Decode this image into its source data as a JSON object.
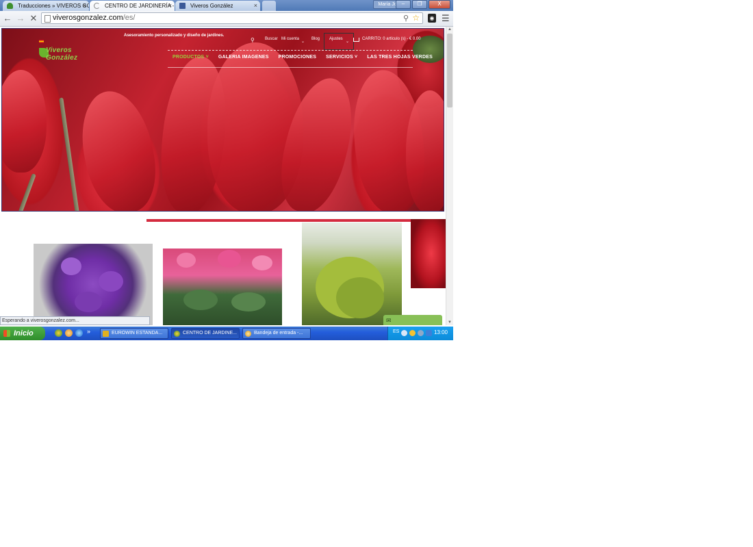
{
  "browser": {
    "tabs": [
      {
        "label": "Traducciones » VIVEROS GO",
        "active": false
      },
      {
        "label": "CENTRO DE JARDINERÍA - G",
        "active": true
      },
      {
        "label": "Viveros González",
        "active": false
      }
    ],
    "close_glyph": "×",
    "user_badge": "María José",
    "window_buttons": {
      "minimize": "–",
      "maximize": "❐",
      "close": "X"
    },
    "url_domain": "viverosgonzalez.com",
    "url_path": "/es/",
    "status_text": "Esperando a viverosgonzalez.com..."
  },
  "site": {
    "tagline": "Asesoramiento personalizado y diseño de jardines.",
    "logo_text": "Viveros González",
    "top_links": {
      "search": "Buscar",
      "account": "Mi cuenta",
      "blog": "Blog",
      "settings": "Ajustes",
      "cart": "CARRITO: 0 artículo (s) - € 0.00"
    },
    "nav": [
      {
        "label": "PRODUCTOS",
        "active": true,
        "dropdown": true
      },
      {
        "label": "GALERIA IMAGENES",
        "active": false,
        "dropdown": false
      },
      {
        "label": "PROMOCIONES",
        "active": false,
        "dropdown": false
      },
      {
        "label": "SERVICIOS",
        "active": false,
        "dropdown": true
      },
      {
        "label": "LAS TRES HOJAS VERDES",
        "active": false,
        "dropdown": false
      }
    ],
    "colors": {
      "accent_green": "#9ccc3c",
      "hero_red": "#c41a27",
      "chat_green": "#88c057"
    }
  },
  "taskbar": {
    "start_label": "Inicio",
    "more_glyph": "»",
    "tasks": [
      {
        "label": "EUROWIN ESTANDA...",
        "active": false
      },
      {
        "label": "CENTRO DE JARDINE...",
        "active": true
      },
      {
        "label": "Bandeja de entrada -...",
        "active": false
      }
    ],
    "language": "ES",
    "time": "13:00"
  }
}
